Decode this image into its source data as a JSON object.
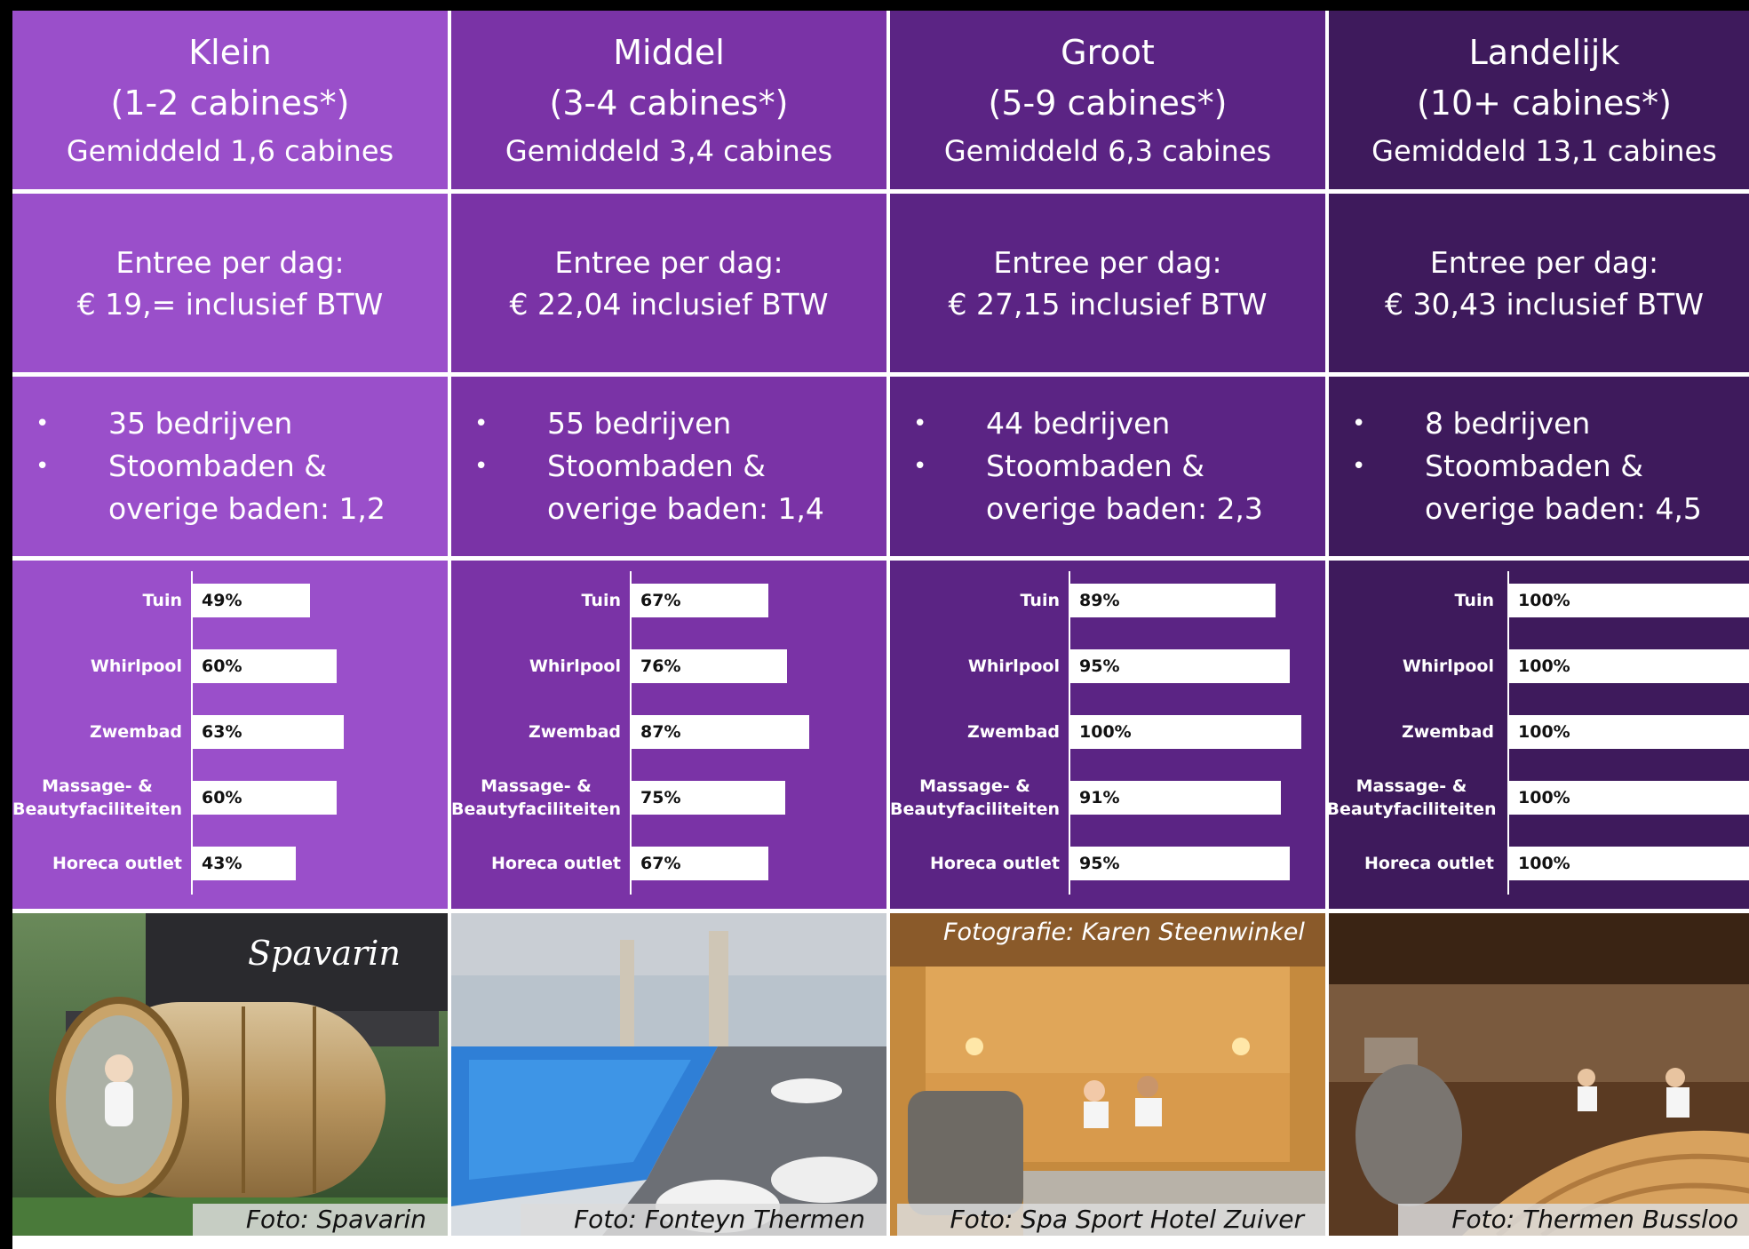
{
  "columns": [
    {
      "title": "Klein",
      "cabins": "(1-2 cabines*)",
      "avg": "Gemiddeld 1,6 cabines",
      "entree_label": "Entree per dag:",
      "entree_price": "€ 19,= inclusief BTW",
      "bullets": [
        "35 bedrijven",
        "Stoombaden &",
        "overige baden: 1,2"
      ],
      "bars": [
        {
          "label": "Tuin",
          "value": 49,
          "text": "49%"
        },
        {
          "label": "Whirlpool",
          "value": 60,
          "text": "60%"
        },
        {
          "label": "Zwembad",
          "value": 63,
          "text": "63%"
        },
        {
          "label": "Massage- & Beautyfaciliteiten",
          "value": 60,
          "text": "60%"
        },
        {
          "label": "Horeca outlet",
          "value": 43,
          "text": "43%"
        }
      ],
      "photo_caption": "Foto: Spavarin",
      "photo_sign": "Spavarin"
    },
    {
      "title": "Middel",
      "cabins": "(3-4 cabines*)",
      "avg": "Gemiddeld 3,4 cabines",
      "entree_label": "Entree per dag:",
      "entree_price": "€ 22,04 inclusief BTW",
      "bullets": [
        "55 bedrijven",
        "Stoombaden &",
        "overige baden: 1,4"
      ],
      "bars": [
        {
          "label": "Tuin",
          "value": 67,
          "text": "67%"
        },
        {
          "label": "Whirlpool",
          "value": 76,
          "text": "76%"
        },
        {
          "label": "Zwembad",
          "value": 87,
          "text": "87%"
        },
        {
          "label": "Massage- & Beautyfaciliteiten",
          "value": 75,
          "text": "75%"
        },
        {
          "label": "Horeca outlet",
          "value": 67,
          "text": "67%"
        }
      ],
      "photo_caption": "Foto: Fonteyn Thermen"
    },
    {
      "title": "Groot",
      "cabins": "(5-9 cabines*)",
      "avg": "Gemiddeld 6,3 cabines",
      "entree_label": "Entree per dag:",
      "entree_price": "€ 27,15 inclusief BTW",
      "bullets": [
        "44 bedrijven",
        "Stoombaden &",
        "overige baden: 2,3"
      ],
      "bars": [
        {
          "label": "Tuin",
          "value": 89,
          "text": "89%"
        },
        {
          "label": "Whirlpool",
          "value": 95,
          "text": "95%"
        },
        {
          "label": "Zwembad",
          "value": 100,
          "text": "100%"
        },
        {
          "label": "Massage- & Beautyfaciliteiten",
          "value": 91,
          "text": "91%"
        },
        {
          "label": "Horeca outlet",
          "value": 95,
          "text": "95%"
        }
      ],
      "photo_caption": "Foto: Spa Sport Hotel Zuiver",
      "photo_top_caption": "Fotografie: Karen Steenwinkel"
    },
    {
      "title": "Landelijk",
      "cabins": "(10+ cabines*)",
      "avg": "Gemiddeld 13,1 cabines",
      "entree_label": "Entree per dag:",
      "entree_price": "€ 30,43 inclusief BTW",
      "bullets": [
        "8 bedrijven",
        "Stoombaden &",
        "overige baden: 4,5"
      ],
      "bars": [
        {
          "label": "Tuin",
          "value": 100,
          "text": "100%"
        },
        {
          "label": "Whirlpool",
          "value": 100,
          "text": "100%"
        },
        {
          "label": "Zwembad",
          "value": 100,
          "text": "100%"
        },
        {
          "label": "Massage- & Beautyfaciliteiten",
          "value": 100,
          "text": "100%"
        },
        {
          "label": "Horeca outlet",
          "value": 100,
          "text": "100%"
        }
      ],
      "photo_caption": "Foto: Thermen Bussloo"
    }
  ],
  "colors": {
    "col0": "#9a4fca",
    "col1": "#7a33a6",
    "col2": "#5b2484",
    "col3": "#3e1a5c"
  },
  "chart_data": [
    {
      "type": "bar",
      "orientation": "horizontal",
      "categories": [
        "Tuin",
        "Whirlpool",
        "Zwembad",
        "Massage- & Beautyfaciliteiten",
        "Horeca outlet"
      ],
      "values": [
        49,
        60,
        63,
        60,
        43
      ],
      "xlim": [
        0,
        100
      ]
    },
    {
      "type": "bar",
      "orientation": "horizontal",
      "categories": [
        "Tuin",
        "Whirlpool",
        "Zwembad",
        "Massage- & Beautyfaciliteiten",
        "Horeca outlet"
      ],
      "values": [
        67,
        76,
        87,
        75,
        67
      ],
      "xlim": [
        0,
        100
      ]
    },
    {
      "type": "bar",
      "orientation": "horizontal",
      "categories": [
        "Tuin",
        "Whirlpool",
        "Zwembad",
        "Massage- & Beautyfaciliteiten",
        "Horeca outlet"
      ],
      "values": [
        89,
        95,
        100,
        91,
        95
      ],
      "xlim": [
        0,
        100
      ]
    },
    {
      "type": "bar",
      "orientation": "horizontal",
      "categories": [
        "Tuin",
        "Whirlpool",
        "Zwembad",
        "Massage- & Beautyfaciliteiten",
        "Horeca outlet"
      ],
      "values": [
        100,
        100,
        100,
        100,
        100
      ],
      "xlim": [
        0,
        100
      ]
    }
  ]
}
